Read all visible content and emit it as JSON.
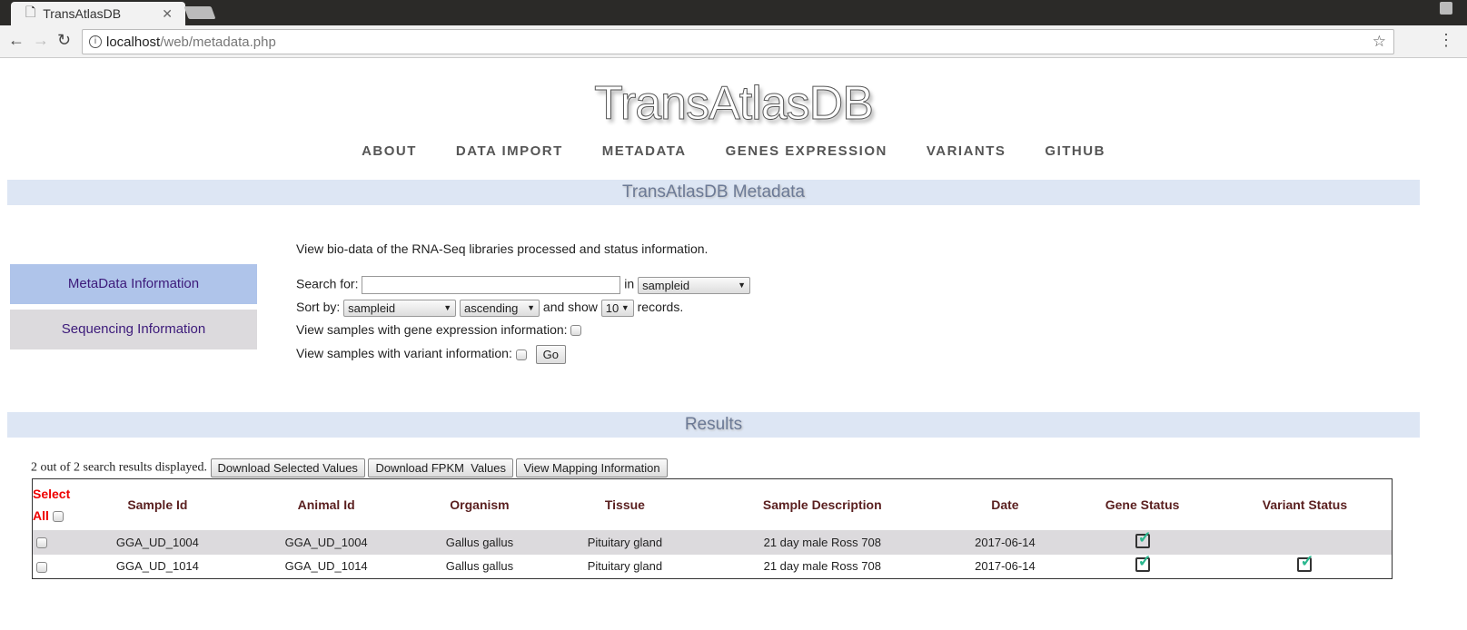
{
  "browser": {
    "tab_title": "TransAtlasDB",
    "url_host": "localhost",
    "url_path": "/web/metadata.php"
  },
  "site": {
    "logo": "TransAtlasDB",
    "nav": [
      "ABOUT",
      "DATA IMPORT",
      "METADATA",
      "GENES EXPRESSION",
      "VARIANTS",
      "GITHUB"
    ],
    "section_title": "TransAtlasDB Metadata",
    "results_title": "Results"
  },
  "sidebar": {
    "items": [
      "MetaData Information",
      "Sequencing Information"
    ]
  },
  "form": {
    "intro": "View bio-data of the RNA-Seq libraries processed and status information.",
    "search_label": "Search for:",
    "search_value": "",
    "in_label": "in",
    "search_field": "sampleid",
    "sort_label": "Sort by:",
    "sort_field": "sampleid",
    "sort_order": "ascending",
    "show_label": "and show",
    "show_count": "10",
    "records_label": "records.",
    "gene_label": "View samples with gene expression information:",
    "variant_label": "View samples with variant information:",
    "go": "Go"
  },
  "results": {
    "count_text": "2 out of 2 search results displayed.",
    "buttons": [
      "Download Selected Values",
      "Download FPKM  Values",
      "View Mapping Information"
    ],
    "select_all": [
      "Select",
      "All"
    ],
    "columns": [
      "Sample Id",
      "Animal Id",
      "Organism",
      "Tissue",
      "Sample Description",
      "Date",
      "Gene Status",
      "Variant Status"
    ],
    "rows": [
      {
        "cells": [
          "GGA_UD_1004",
          "GGA_UD_1004",
          "Gallus gallus",
          "Pituitary gland",
          "21 day male Ross 708",
          "2017-06-14"
        ],
        "gene": true,
        "variant": false
      },
      {
        "cells": [
          "GGA_UD_1014",
          "GGA_UD_1014",
          "Gallus gallus",
          "Pituitary gland",
          "21 day male Ross 708",
          "2017-06-14"
        ],
        "gene": true,
        "variant": true
      }
    ]
  }
}
